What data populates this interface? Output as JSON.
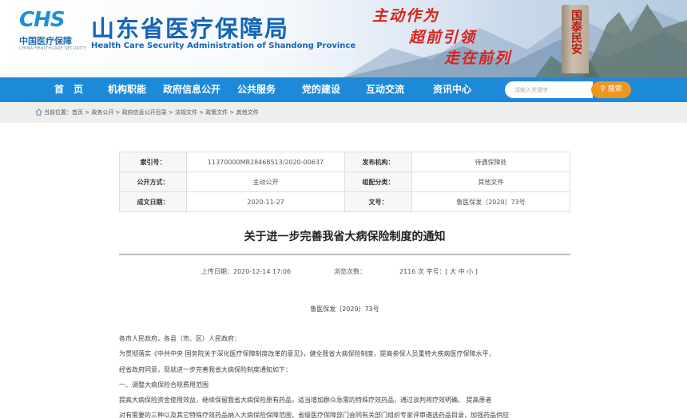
{
  "header": {
    "logo_mark": "CHS",
    "logo_cn": "中国医疗保障",
    "logo_en": "CHINA HEALTHCARE SECURITY",
    "title_cn": "山东省医疗保障局",
    "title_en": "Health Care Security Administration of Shandong Province",
    "slogans": [
      "主动作为",
      "超前引领",
      "走在前列"
    ],
    "stele_text": "国泰民安"
  },
  "nav": {
    "items": [
      "首　页",
      "机构职能",
      "政府信息公开",
      "公共服务",
      "党的建设",
      "互动交流",
      "资讯中心"
    ],
    "search_placeholder": "请输入关键字",
    "search_label": "搜索"
  },
  "breadcrumb": "当前位置：首页 > 政务公开 > 政府信息公开目录 > 法规文件 > 政策文件 > 其他文件",
  "meta": {
    "index_label": "索引号：",
    "index_value": "11370000MB28468513/2020-00637",
    "publisher_label": "发布机构：",
    "publisher_value": "待遇保障处",
    "mode_label": "公开方式：",
    "mode_value": "主动公开",
    "category_label": "组配分类：",
    "category_value": "其他文件",
    "date_label": "成文日期：",
    "date_value": "2020-11-27",
    "docnum_label": "文号：",
    "docnum_value": "鲁医保发〔2020〕73号"
  },
  "article": {
    "title": "关于进一步完善我省大病保险制度的通知",
    "upload": "上传日期：2020-12-14 17:06",
    "views": "浏览次数：",
    "views_count": "2116",
    "fontsize_label": "次 字号：[",
    "fontsize_large": "大",
    "fontsize_medium": "中",
    "fontsize_small": "小",
    "fontsize_end": "]",
    "doc_number": "鲁医保发〔2020〕73号",
    "paragraphs": [
      "各市人民政府，各县（市、区）人民政府：",
      "为贯彻落实《中共中央 国务院关于深化医疗保障制度改革的意见》，健全我省大病保险制度，提高参保人员重特大疾病医疗保障水平，",
      "经省政府同意，现就进一步完善我省大病保险制度通知如下：",
      "一、调整大病保险合规费用范围",
      "提高大病保险资金使用效益，继续保留我省大病保险原有药品，适当增加群众急需的特殊疗效药品，通过谈判将疗效明确、  提高患者",
      "对有需要的三种以及其它特殊疗效药品纳入大病保险保障范围，省级医疗保障部门会同有关部门组织专家评审遴选药品目录，加强药品供应"
    ]
  }
}
